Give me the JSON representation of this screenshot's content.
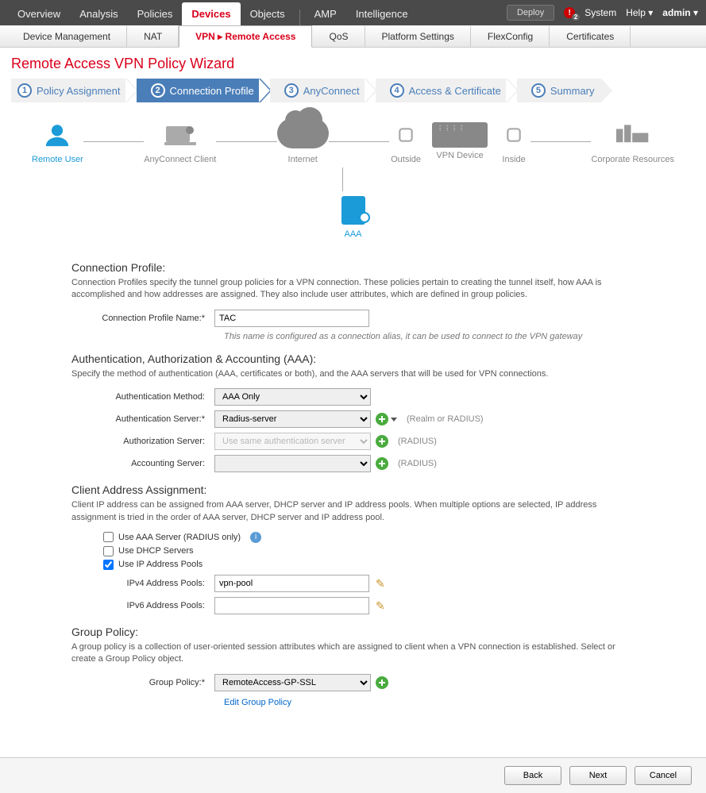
{
  "topnav": {
    "tabs": [
      "Overview",
      "Analysis",
      "Policies",
      "Devices",
      "Objects",
      "AMP",
      "Intelligence"
    ],
    "active": "Devices",
    "deploy": "Deploy",
    "system": "System",
    "help": "Help",
    "user": "admin",
    "alert_count": "2"
  },
  "subnav": {
    "items": [
      "Device Management",
      "NAT",
      "VPN ▸ Remote Access",
      "QoS",
      "Platform Settings",
      "FlexConfig",
      "Certificates"
    ],
    "active_index": 2
  },
  "wizard": {
    "title": "Remote Access VPN Policy Wizard",
    "steps": [
      {
        "num": "1",
        "label": "Policy Assignment"
      },
      {
        "num": "2",
        "label": "Connection Profile"
      },
      {
        "num": "3",
        "label": "AnyConnect"
      },
      {
        "num": "4",
        "label": "Access & Certificate"
      },
      {
        "num": "5",
        "label": "Summary"
      }
    ],
    "active_step": 1
  },
  "diagram": {
    "remote_user": "Remote User",
    "anyconnect": "AnyConnect Client",
    "internet": "Internet",
    "outside": "Outside",
    "vpn_device": "VPN Device",
    "inside": "Inside",
    "corp": "Corporate Resources",
    "aaa": "AAA"
  },
  "conn_profile": {
    "heading": "Connection Profile:",
    "desc": "Connection Profiles specify the tunnel group policies for a VPN connection. These policies pertain to creating the tunnel itself, how AAA is accomplished and how addresses are assigned. They also include user attributes, which are defined in group policies.",
    "name_label": "Connection Profile Name:*",
    "name_value": "TAC",
    "name_hint": "This name is configured as a connection alias, it can be used to connect to the VPN gateway"
  },
  "aaa": {
    "heading": "Authentication, Authorization & Accounting (AAA):",
    "desc": "Specify the method of authentication (AAA, certificates or both), and the AAA servers that will be used for VPN connections.",
    "auth_method_label": "Authentication Method:",
    "auth_method_value": "AAA Only",
    "auth_server_label": "Authentication Server:*",
    "auth_server_value": "Radius-server",
    "auth_server_hint": "(Realm or RADIUS)",
    "authz_label": "Authorization Server:",
    "authz_value": "Use same authentication server",
    "authz_hint": "(RADIUS)",
    "acct_label": "Accounting Server:",
    "acct_value": "",
    "acct_hint": "(RADIUS)"
  },
  "client_addr": {
    "heading": "Client Address Assignment:",
    "desc": "Client IP address can be assigned from AAA server, DHCP server and IP address pools. When multiple options are selected, IP address assignment is tried in the order of AAA server, DHCP server and IP address pool.",
    "cb_aaa": "Use AAA Server (RADIUS only)",
    "cb_dhcp": "Use DHCP Servers",
    "cb_pools": "Use IP Address Pools",
    "cb_aaa_checked": false,
    "cb_dhcp_checked": false,
    "cb_pools_checked": true,
    "ipv4_label": "IPv4 Address Pools:",
    "ipv4_value": "vpn-pool",
    "ipv6_label": "IPv6 Address Pools:",
    "ipv6_value": ""
  },
  "group_policy": {
    "heading": "Group Policy:",
    "desc": "A group policy is a collection of user-oriented session attributes which are assigned to client when a VPN connection is established. Select or create a Group Policy object.",
    "label": "Group Policy:*",
    "value": "RemoteAccess-GP-SSL",
    "edit_link": "Edit Group Policy"
  },
  "footer": {
    "back": "Back",
    "next": "Next",
    "cancel": "Cancel"
  }
}
